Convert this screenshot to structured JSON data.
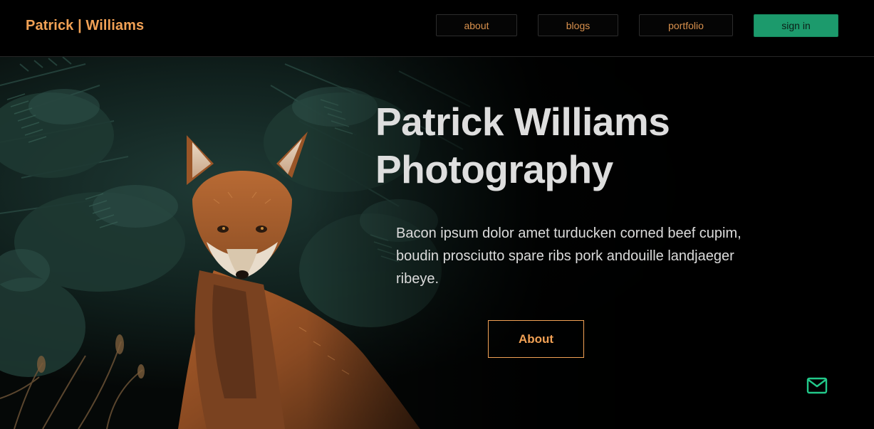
{
  "navbar": {
    "brand": "Patrick | Williams",
    "links": {
      "about": "about",
      "blogs": "blogs",
      "portfolio": "portfolio"
    },
    "signin_label": "sign in"
  },
  "hero": {
    "title_line1": "Patrick Williams",
    "title_line2": "Photography",
    "body": "Bacon ipsum dolor amet turducken corned beef cupim, boudin prosciutto spare ribs pork andouille landjaeger ribeye.",
    "cta_label": "About",
    "image_subject": "red fox among pine branches"
  },
  "icons": {
    "mail": "mail-icon"
  },
  "colors": {
    "accent_orange": "#f1a155",
    "signin_green": "#1c9a6c",
    "mail_icon_green": "#22c98a",
    "background": "#000000"
  }
}
